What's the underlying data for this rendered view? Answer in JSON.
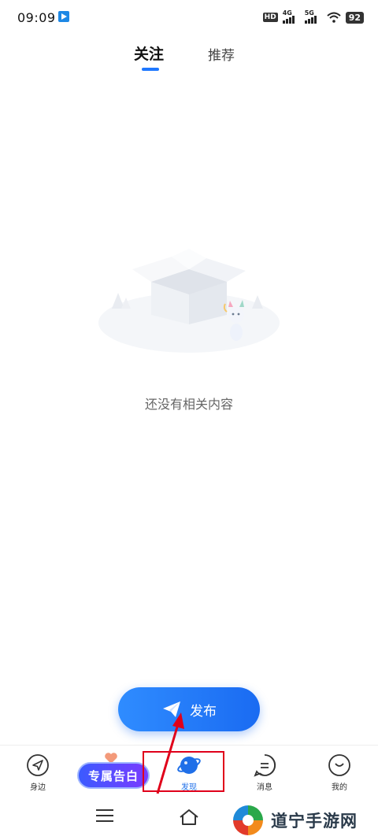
{
  "status_bar": {
    "time": "09:09",
    "hd": "HD",
    "network_1": "4G",
    "network_2": "5G",
    "battery": "92"
  },
  "tabs": [
    {
      "label": "关注",
      "active": true
    },
    {
      "label": "推荐",
      "active": false
    }
  ],
  "empty_state": {
    "message": "还没有相关内容"
  },
  "publish_button": {
    "label": "发布",
    "icon": "paper-plane-icon"
  },
  "promo": {
    "label": "专属告白"
  },
  "bottom_nav": [
    {
      "label": "身边",
      "icon": "location-arrow-icon"
    },
    {
      "label": "发现",
      "icon": "planet-icon",
      "active": true
    },
    {
      "label": "消息",
      "icon": "chat-bubble-icon"
    },
    {
      "label": "我的",
      "icon": "smiley-face-icon"
    }
  ],
  "watermark": {
    "text": "道宁手游网"
  },
  "colors": {
    "accent": "#1f78ff",
    "highlight": "#e0001a"
  }
}
